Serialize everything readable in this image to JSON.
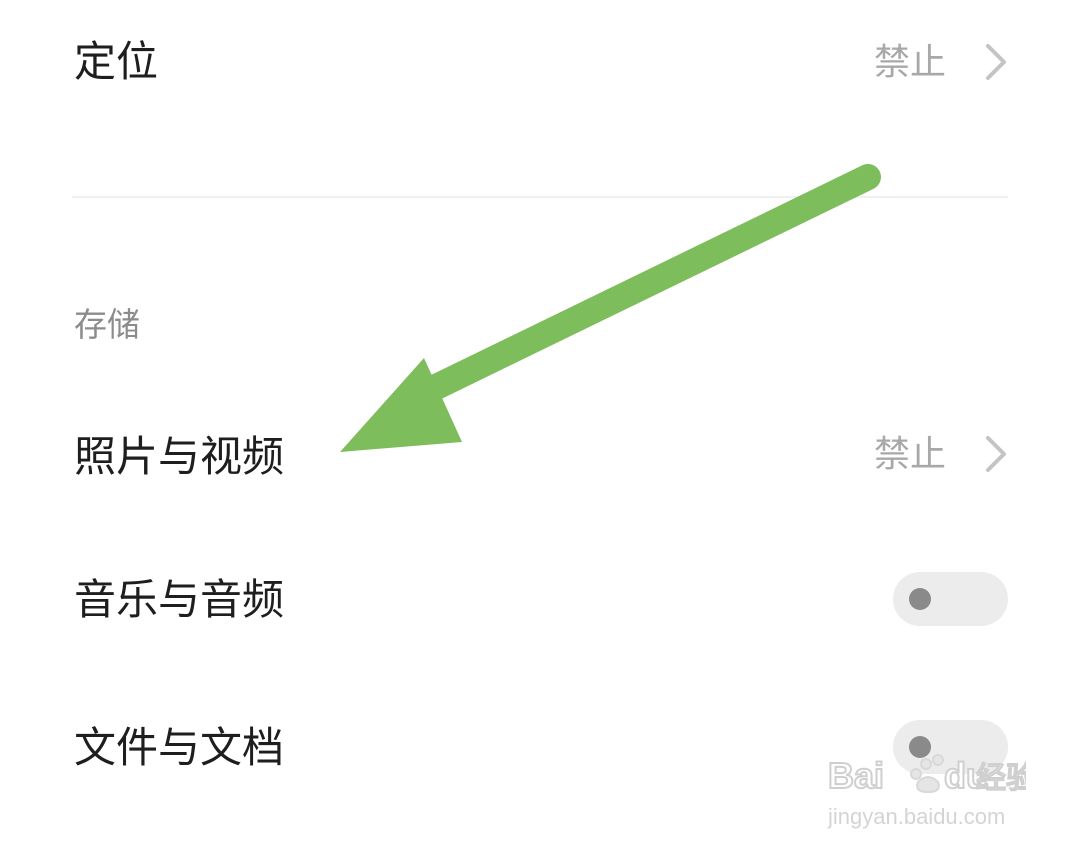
{
  "rows": {
    "location": {
      "label": "定位",
      "value": "禁止"
    },
    "photos": {
      "label": "照片与视频",
      "value": "禁止"
    },
    "music": {
      "label": "音乐与音频",
      "toggle_state": "off"
    },
    "files": {
      "label": "文件与文档",
      "toggle_state": "off"
    }
  },
  "section": {
    "storage_header": "存储"
  },
  "colors": {
    "annotation_arrow": "#7dbd5b",
    "toggle_track": "#ececec",
    "toggle_knob": "#8a8a8a"
  },
  "watermark": {
    "brand": "Baidu经验",
    "url": "jingyan.baidu.com"
  }
}
